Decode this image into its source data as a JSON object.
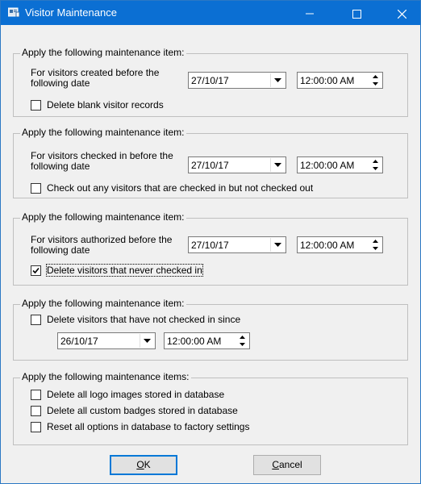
{
  "window": {
    "title": "Visitor Maintenance",
    "icon": "app-icon",
    "controls": {
      "minimize": "—",
      "maximize": "☐",
      "close": "✕"
    }
  },
  "groups": [
    {
      "legend": "Apply the following maintenance item:",
      "description": "For visitors created before the following date",
      "date": "27/10/17",
      "time": "12:00:00 AM",
      "checkbox": {
        "label": "Delete blank visitor records",
        "checked": false
      }
    },
    {
      "legend": "Apply the following maintenance item:",
      "description": "For visitors checked in before the following date",
      "date": "27/10/17",
      "time": "12:00:00 AM",
      "checkbox": {
        "label": "Check out any visitors that are checked in but not checked out",
        "checked": false
      }
    },
    {
      "legend": "Apply the following maintenance item:",
      "description": "For visitors authorized before the following date",
      "date": "27/10/17",
      "time": "12:00:00 AM",
      "checkbox": {
        "label": "Delete visitors that never checked in",
        "checked": true
      }
    },
    {
      "legend": "Apply the following maintenance item:",
      "checkbox": {
        "label": "Delete visitors that have not checked in since",
        "checked": false
      },
      "date": "26/10/17",
      "time": "12:00:00 AM"
    },
    {
      "legend": "Apply the following maintenance items:",
      "checkboxes": [
        {
          "label": "Delete all logo images stored in database",
          "checked": false
        },
        {
          "label": "Delete all custom badges stored in database",
          "checked": false
        },
        {
          "label": "Reset all options in database to factory settings",
          "checked": false
        }
      ]
    }
  ],
  "buttons": {
    "ok_accel": "O",
    "ok_rest": "K",
    "cancel_accel": "C",
    "cancel_rest": "ancel"
  },
  "colors": {
    "titlebar": "#0b6fd3",
    "accent": "#0078d7"
  }
}
